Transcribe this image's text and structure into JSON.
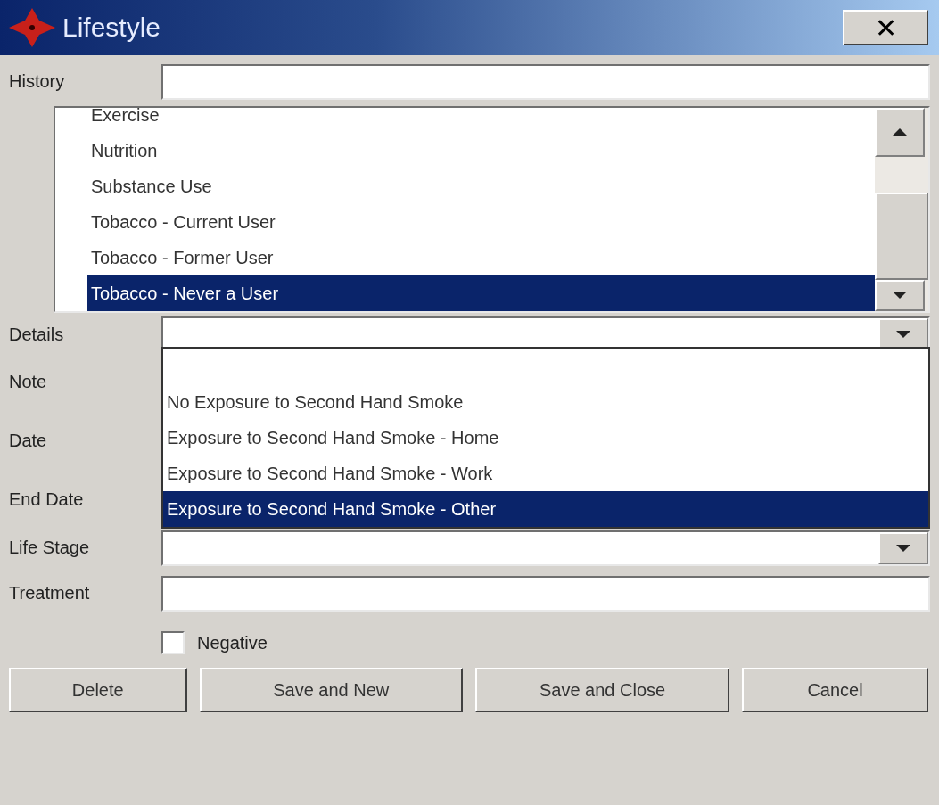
{
  "window": {
    "title": "Lifestyle",
    "close": "✕"
  },
  "history": {
    "label": "History"
  },
  "history_list": [
    {
      "label": "Exercise",
      "selected": false
    },
    {
      "label": "Nutrition",
      "selected": false
    },
    {
      "label": "Substance Use",
      "selected": false
    },
    {
      "label": "Tobacco - Current User",
      "selected": false
    },
    {
      "label": "Tobacco - Former User",
      "selected": false
    },
    {
      "label": "Tobacco - Never a User",
      "selected": true
    }
  ],
  "details": {
    "label": "Details",
    "expanded": true,
    "options": [
      {
        "label": "No Exposure to Second Hand Smoke",
        "selected": false
      },
      {
        "label": "Exposure to Second Hand Smoke - Home",
        "selected": false
      },
      {
        "label": "Exposure to Second Hand Smoke - Work",
        "selected": false
      },
      {
        "label": "Exposure to Second Hand Smoke - Other",
        "selected": true
      }
    ]
  },
  "covered_rows": [
    {
      "label": "Note"
    },
    {
      "label": "Date"
    },
    {
      "label": "End Date"
    }
  ],
  "life_stage": {
    "label": "Life Stage"
  },
  "treatment": {
    "label": "Treatment"
  },
  "negative": {
    "label": "Negative",
    "checked": false
  },
  "buttons": [
    "Delete",
    "Save and New",
    "Save and Close",
    "Cancel"
  ]
}
